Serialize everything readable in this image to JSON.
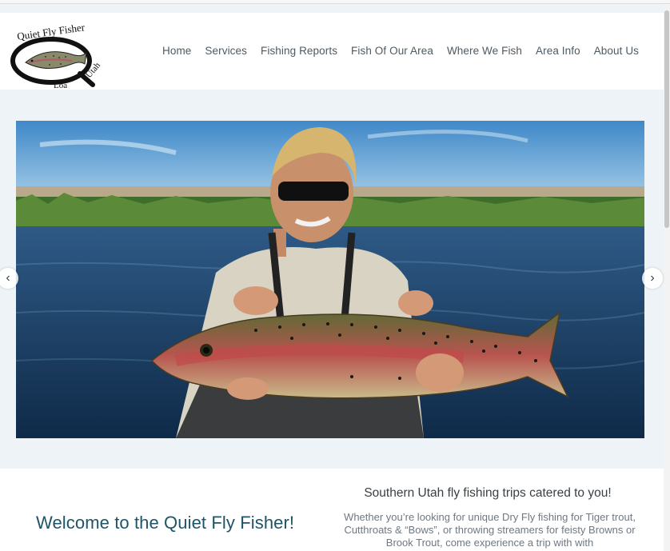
{
  "logo": {
    "top_text": "Quiet Fly Fisher",
    "bottom_left": "Loa",
    "bottom_right": "Utah"
  },
  "nav": {
    "items": [
      {
        "label": "Home"
      },
      {
        "label": "Services"
      },
      {
        "label": "Fishing Reports"
      },
      {
        "label": "Fish Of Our Area"
      },
      {
        "label": "Where We Fish"
      },
      {
        "label": "Area Info"
      },
      {
        "label": "About Us"
      }
    ]
  },
  "slider": {
    "prev_icon": "chevron-left-icon",
    "next_icon": "chevron-right-icon",
    "prev_glyph": "‹",
    "next_glyph": "›"
  },
  "main": {
    "welcome": "Welcome to the Quiet Fly Fisher!",
    "tagline": "Southern Utah fly fishing trips catered to you!",
    "intro": "Whether you’re looking for unique Dry Fly fishing for Tiger trout, Cutthroats & “Bows”, or throwing streamers for feisty Browns or Brook Trout, come experience a trip with with"
  },
  "colors": {
    "heading": "#1f5468",
    "nav_text": "#4d5a63",
    "page_bg": "#eef3f7"
  }
}
